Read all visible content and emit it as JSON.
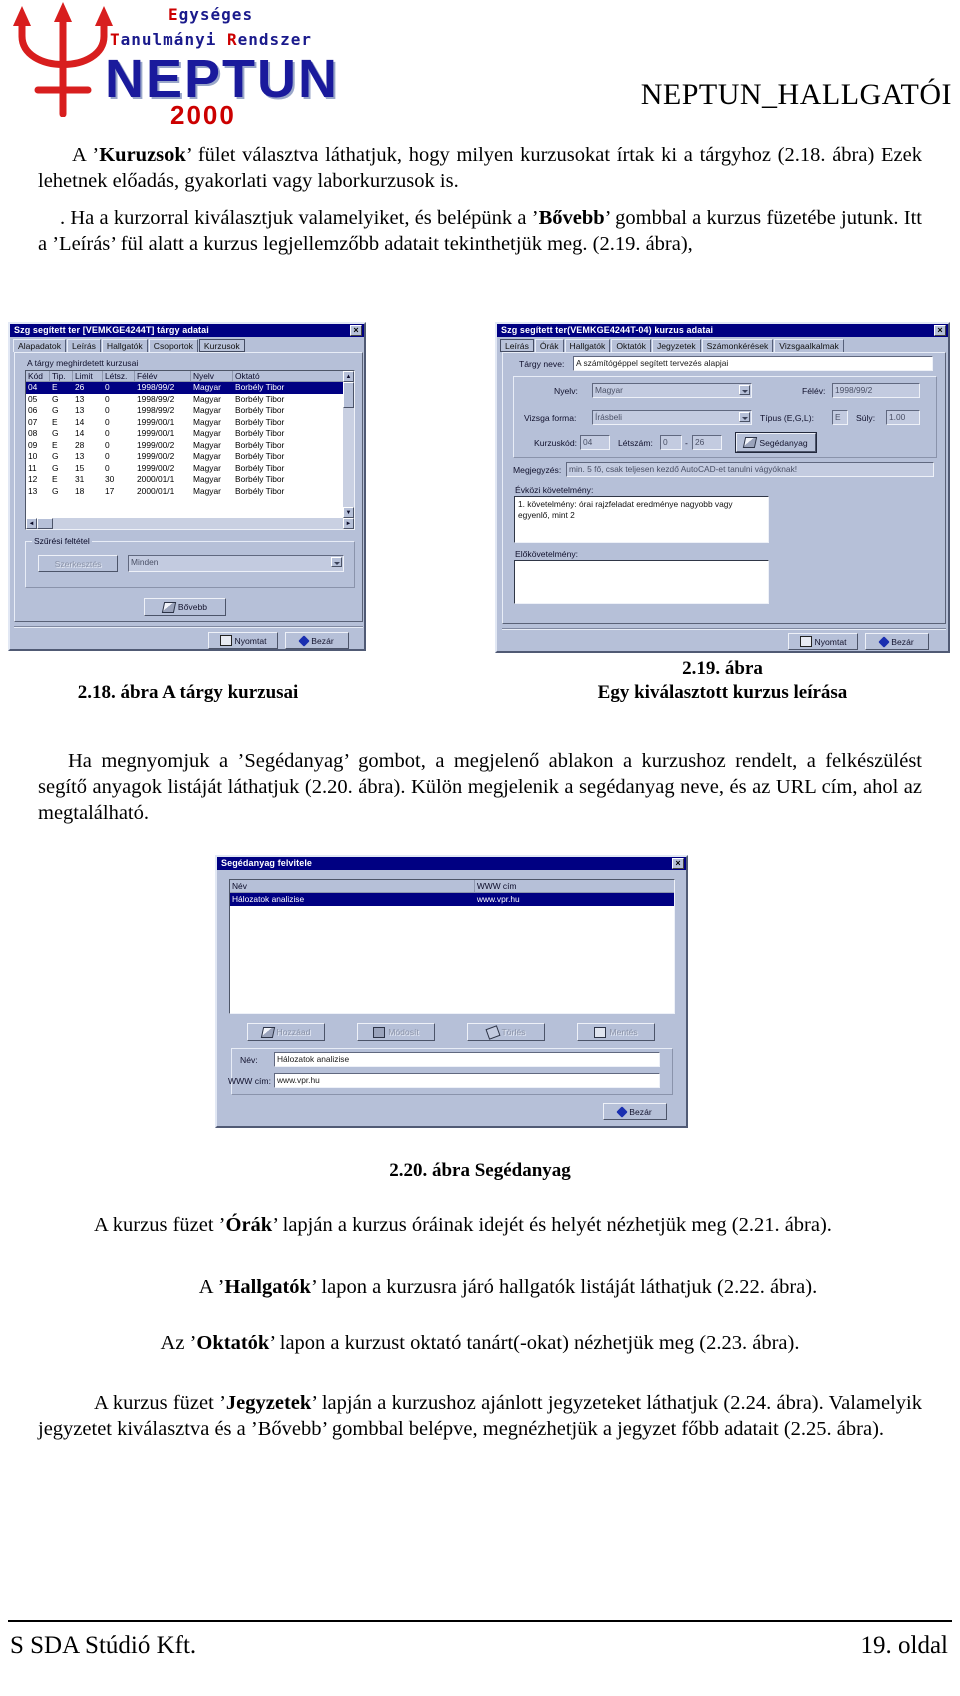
{
  "header": {
    "logo": {
      "line1": "Egységes",
      "line2": "Tanulmányi Rendszer",
      "wordmark": "NEPTUN",
      "year": "2000"
    },
    "doc_title": "NEPTUN_HALLGATÓI"
  },
  "paragraphs": {
    "p1_a": "A ’",
    "p1_b": "Kuruzsok",
    "p1_c": "’ fület választva láthatjuk, hogy milyen kurzusokat írtak ki a tárgyhoz (2.18. ábra) Ezek lehetnek előadás, gyakorlati vagy laborkurzusok is.",
    "p2_a": ". Ha a kurzorral kiválasztjuk valamelyiket, és belépünk a ’",
    "p2_b": "Bővebb",
    "p2_c": "’ gombbal a kurzus füzetébe jutunk. Itt a ’Leírás’ fül alatt a kurzus legjellemzőbb adatait tekinthetjük meg. (2.19. ábra),",
    "p3": "Ha megnyomjuk a ’Segédanyag’ gombot, a megjelenő ablakon a kurzushoz rendelt, a felkészülést segítő anyagok listáját láthatjuk (2.20. ábra). Külön megjelenik a segédanyag neve, és az URL cím, ahol az megtalálható.",
    "p4_a": "A kurzus füzet ’",
    "p4_b": "Órák",
    "p4_c": "’ lapján a kurzus óráinak idejét és helyét nézhetjük meg (2.21. ábra).",
    "p5_a": "A ’",
    "p5_b": "Hallgatók",
    "p5_c": "’ lapon a kurzusra járó hallgatók listáját láthatjuk (2.22. ábra).",
    "p6_a": "Az ’",
    "p6_b": "Oktatók",
    "p6_c": "’ lapon a kurzust oktató tanárt(-okat) nézhetjük meg (2.23. ábra).",
    "p7_a": "A kurzus füzet ’",
    "p7_b": "Jegyzetek",
    "p7_c": "’ lapján a kurzushoz ajánlott jegyzeteket láthatjuk (2.24. ábra). Valamelyik jegyzetet kiválasztva és a ’Bővebb’ gombbal belépve, megnézhetjük a jegyzet főbb adatait (2.25. ábra)."
  },
  "fig218": {
    "window_title": "Szg segített ter [VEMKGE4244T] tárgy adatai",
    "close_label": "×",
    "tabs": [
      {
        "label": "Alapadatok",
        "selected": false
      },
      {
        "label": "Leírás",
        "selected": false
      },
      {
        "label": "Hallgatók",
        "selected": false
      },
      {
        "label": "Csoportok",
        "selected": false
      },
      {
        "label": "Kurzusok",
        "selected": true
      }
    ],
    "group_label": "A tárgy meghirdetett kurzusai",
    "columns": [
      "Kód",
      "Tip.",
      "Limit",
      "Létsz.",
      "Félév",
      "Nyelv",
      "Oktató"
    ],
    "rows": [
      {
        "kod": "04",
        "tip": "E",
        "limit": "26",
        "letsz": "0",
        "felev": "1998/99/2",
        "nyelv": "Magyar",
        "oktato": "Borbély Tibor",
        "selected": true
      },
      {
        "kod": "05",
        "tip": "G",
        "limit": "13",
        "letsz": "0",
        "felev": "1998/99/2",
        "nyelv": "Magyar",
        "oktato": "Borbély Tibor",
        "selected": false
      },
      {
        "kod": "06",
        "tip": "G",
        "limit": "13",
        "letsz": "0",
        "felev": "1998/99/2",
        "nyelv": "Magyar",
        "oktato": "Borbély Tibor",
        "selected": false
      },
      {
        "kod": "07",
        "tip": "E",
        "limit": "14",
        "letsz": "0",
        "felev": "1999/00/1",
        "nyelv": "Magyar",
        "oktato": "Borbély Tibor",
        "selected": false
      },
      {
        "kod": "08",
        "tip": "G",
        "limit": "14",
        "letsz": "0",
        "felev": "1999/00/1",
        "nyelv": "Magyar",
        "oktato": "Borbély Tibor",
        "selected": false
      },
      {
        "kod": "09",
        "tip": "E",
        "limit": "28",
        "letsz": "0",
        "felev": "1999/00/2",
        "nyelv": "Magyar",
        "oktato": "Borbély Tibor",
        "selected": false
      },
      {
        "kod": "10",
        "tip": "G",
        "limit": "13",
        "letsz": "0",
        "felev": "1999/00/2",
        "nyelv": "Magyar",
        "oktato": "Borbély Tibor",
        "selected": false
      },
      {
        "kod": "11",
        "tip": "G",
        "limit": "15",
        "letsz": "0",
        "felev": "1999/00/2",
        "nyelv": "Magyar",
        "oktato": "Borbély Tibor",
        "selected": false
      },
      {
        "kod": "12",
        "tip": "E",
        "limit": "31",
        "letsz": "30",
        "felev": "2000/01/1",
        "nyelv": "Magyar",
        "oktato": "Borbély Tibor",
        "selected": false
      },
      {
        "kod": "13",
        "tip": "G",
        "limit": "18",
        "letsz": "17",
        "felev": "2000/01/1",
        "nyelv": "Magyar",
        "oktato": "Borbély Tibor",
        "selected": false
      }
    ],
    "filter_group_label": "Szűrési feltétel",
    "filter_edit_button": "Szerkesztés",
    "filter_value": "Minden",
    "more_button": "Bővebb",
    "print_button": "Nyomtat",
    "close_button": "Bezár"
  },
  "fig219": {
    "window_title": "Szg segített ter(VEMKGE4244T-04) kurzus adatai",
    "close_label": "×",
    "tabs": [
      {
        "label": "Leírás",
        "selected": true
      },
      {
        "label": "Órák",
        "selected": false
      },
      {
        "label": "Hallgatók",
        "selected": false
      },
      {
        "label": "Oktatók",
        "selected": false
      },
      {
        "label": "Jegyzetek",
        "selected": false
      },
      {
        "label": "Számonkérések",
        "selected": false
      },
      {
        "label": "Vizsgaalkalmak",
        "selected": false
      }
    ],
    "subject_name_label": "Tárgy neve:",
    "subject_name_value": "A számítógéppel segített tervezés alapjai",
    "language_label": "Nyelv:",
    "language_value": "Magyar",
    "term_label": "Félév:",
    "term_value": "1998/99/2",
    "exam_form_label": "Vizsga forma:",
    "exam_form_value": "Írásbeli",
    "type_label": "Típus (E,G,L):",
    "type_value": "E",
    "weight_label": "Súly:",
    "weight_value": "1.00",
    "course_code_label": "Kurzuskód:",
    "course_code_value": "04",
    "headcount_label": "Létszám:",
    "headcount_value": "0",
    "headcount_max": "26",
    "material_button": "Segédanyag",
    "note_label": "Megjegyzés:",
    "note_value": "min. 5 fő, csak teljesen kezdő AutoCAD-et tanulni vágyóknak!",
    "midterm_label": "Évközi követelmény:",
    "midterm_value": "1. követelmény: órai rajzfeladat eredménye nagyobb vagy egyenlő, mint 2",
    "prereq_label": "Előkövetelmény:",
    "prereq_value": "",
    "print_button": "Nyomtat",
    "close_button": "Bezár"
  },
  "fig220": {
    "window_title": "Segédanyag felvitele",
    "close_label": "×",
    "columns": [
      "Név",
      "WWW cím"
    ],
    "rows": [
      {
        "nev": "Hálozatok analizise",
        "www": "www.vpr.hu",
        "selected": true
      }
    ],
    "buttons": [
      "Hozzáad",
      "Módosít",
      "Törlés",
      "Mentés"
    ],
    "name_label": "Név:",
    "name_value": "Hálozatok analizise",
    "url_label": "WWW cím:",
    "url_value": "www.vpr.hu",
    "close_button": "Bezár"
  },
  "captions": {
    "c218": "2.18. ábra A tárgy kurzusai",
    "c219_line1": "2.19. ábra",
    "c219_line2": "Egy kiválasztott kurzus leírása",
    "c220": "2.20. ábra Segédanyag"
  },
  "footer": {
    "left": "S SDA Stúdió Kft.",
    "right": "19. oldal"
  }
}
